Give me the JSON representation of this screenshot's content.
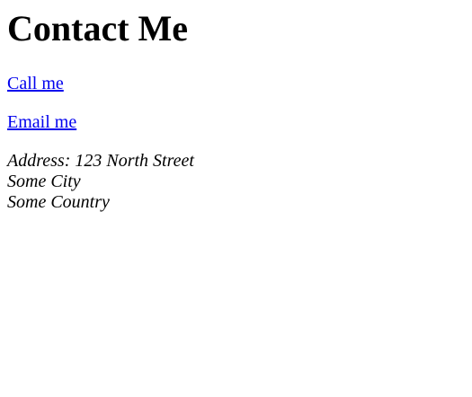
{
  "page": {
    "title": "Contact Me",
    "links": {
      "call": "Call me",
      "email": "Email me"
    },
    "address": {
      "line1": "Address: 123 North Street",
      "line2": "Some City",
      "line3": "Some Country"
    }
  },
  "colors": {
    "link": "#0000ee",
    "text": "#000000",
    "background": "#ffffff"
  }
}
